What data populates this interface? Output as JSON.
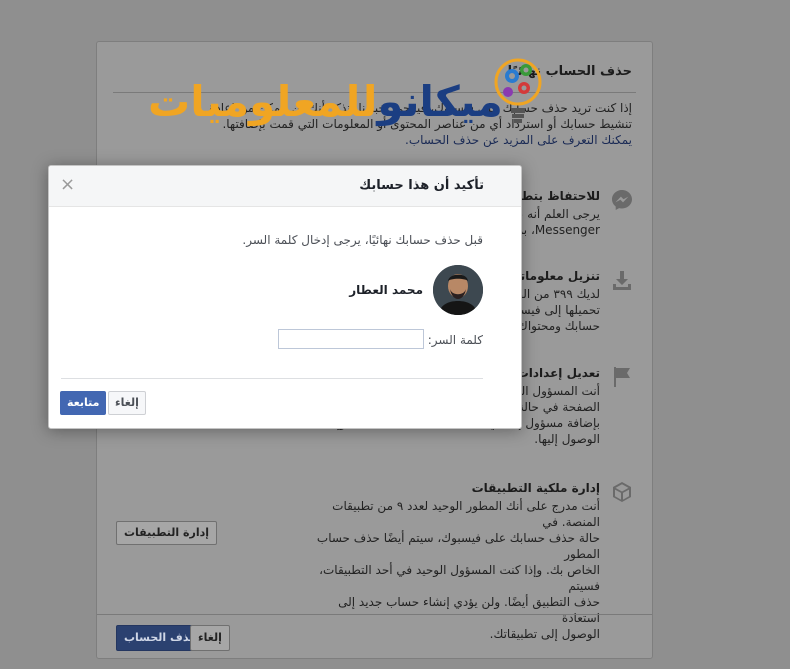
{
  "background": {
    "title": "حذف الحساب نهائيًا",
    "intro_line1": "إذا كنت تريد حذف حسابك على فيسبوك، فيرجى إخبارنا. تذكر أنك لن تتمكن من إعادة",
    "intro_line2": "تنشيط حسابك أو استرداد أي من عناصر المحتوى أو المعلومات التي قمت بإضافتها.",
    "intro_link": "يمكنك التعرف على المزيد عن حذف الحساب.",
    "sections": [
      {
        "title": "للاحتفاظ بتطبيق Messenger",
        "icon": "messenger-icon",
        "lines": [
          "يرجى العلم أنه عند حذف حسابك ستتمكن من",
          "Messenger، بما في ذلك الرسائل."
        ]
      },
      {
        "title": "تنزيل معلوماتك",
        "icon": "download-icon",
        "lines": [
          "لديك ٣٩٩ من الصور",
          "تحميلها إلى فيسبوك.",
          "حسابك ومحتواك نهائيًا."
        ]
      },
      {
        "title": "تعديل إعدادات مسؤول الصفحة",
        "icon": "flag-icon",
        "lines": [
          "أنت المسؤول الوحيد",
          "الصفحة في حالة حذف",
          "بإضافة مسؤول إضافي للحفاظ على نشاط الصفحة وإمكانية",
          "الوصول إليها."
        ]
      },
      {
        "title": "إدارة ملكية التطبيقات",
        "icon": "app-box-icon",
        "lines": [
          "أنت مدرج على أنك المطور الوحيد لعدد ٩ من تطبيقات المنصة. في",
          "حالة حذف حسابك على فيسبوك، سيتم أيضًا حذف حساب المطور",
          "الخاص بك. وإذا كنت المسؤول الوحيد في أحد التطبيقات، فسيتم",
          "حذف التطبيق أيضًا. ولن يؤدي إنشاء حساب جديد إلى استعادة",
          "الوصول إلى تطبيقاتك."
        ]
      }
    ],
    "manage_apps_button": "إدارة التطبيقات",
    "delete_account_button": "حذف الحساب",
    "cancel_button": "إلغاء"
  },
  "logo": {
    "text_blue": "ميكانو",
    "text_orange": "للمعلوميات"
  },
  "modal": {
    "title": "تأكيد أن هذا حسابك",
    "close_label": "×",
    "message": "قبل حذف حسابك نهائيًا، يرجى إدخال كلمة السر.",
    "user_name": "محمد العطار",
    "password_label": "كلمة السر:",
    "password_value": "",
    "continue_button": "متابعة",
    "cancel_button": "إلغاء"
  },
  "colors": {
    "primary_blue": "#4267b2",
    "overlay": "#8f8f8f",
    "logo_blue": "#1b3e82",
    "logo_orange": "#f0a523"
  }
}
